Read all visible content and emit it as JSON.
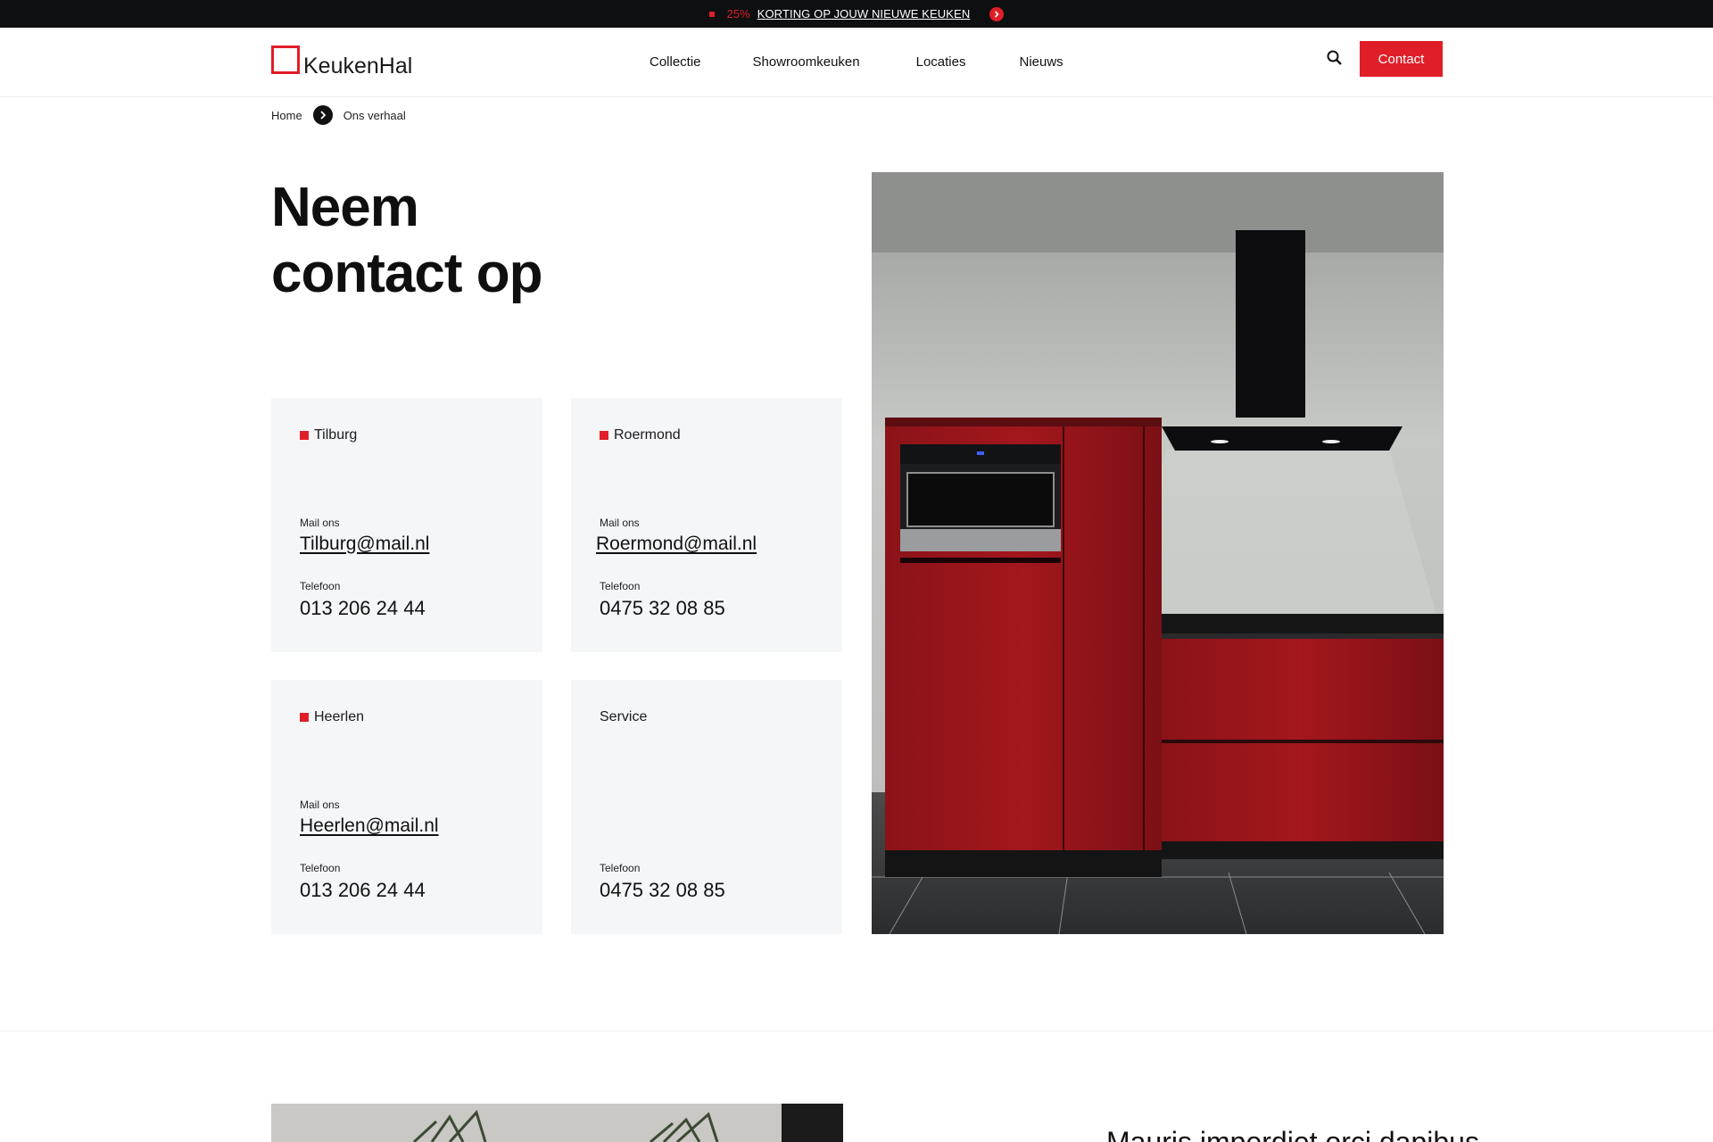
{
  "promo": {
    "percent": "25%",
    "text": "KORTING OP JOUW NIEUWE KEUKEN",
    "accent": "#e01e28"
  },
  "header": {
    "logo_text": "KeukenHal",
    "nav": [
      "Collectie",
      "Showroomkeuken",
      "Locaties",
      "Nieuws"
    ],
    "search_icon": "search-icon",
    "contact_label": "Contact"
  },
  "breadcrumb": {
    "home": "Home",
    "current": "Ons verhaal",
    "separator_icon": "chevron-right-icon"
  },
  "hero": {
    "title_line1": "Neem",
    "title_line2": "contact op"
  },
  "locations": [
    {
      "city": "Tilburg",
      "mail_label": "Mail ons",
      "mail": "Tilburg@mail.nl",
      "tel_label": "Telefoon",
      "tel": "013 206 24 44"
    },
    {
      "city": "Roermond",
      "mail_label": "Mail ons",
      "mail": "Roermond@mail.nl",
      "tel_label": "Telefoon",
      "tel": "0475 32 08 85"
    },
    {
      "city": "Heerlen",
      "mail_label": "Mail ons",
      "mail": "Heerlen@mail.nl",
      "tel_label": "Telefoon",
      "tel": "013 206 24 44"
    },
    {
      "city": "Service",
      "tel_label": "Telefoon",
      "tel": "0475 32 08 85"
    }
  ],
  "lower": {
    "heading": "Mauris imperdiet orci dapibus"
  },
  "colors": {
    "brand_red": "#e01e28",
    "card_bg": "#f5f6f8",
    "dark_bar": "#0e0f11"
  }
}
